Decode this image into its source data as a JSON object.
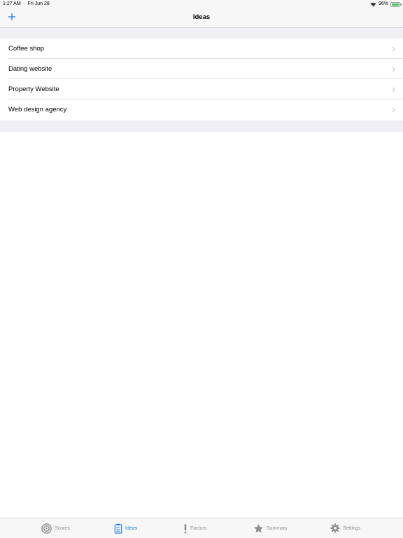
{
  "status_bar": {
    "time": "1:27 AM",
    "date": "Fri Jun 28",
    "battery": "96%",
    "battery_level": 0.96
  },
  "nav": {
    "title": "Ideas",
    "add_icon": "plus-icon"
  },
  "ideas": [
    {
      "label": "Coffee shop"
    },
    {
      "label": "Dating website"
    },
    {
      "label": "Property Website"
    },
    {
      "label": "Web design agency"
    }
  ],
  "tabs": [
    {
      "label": "Scores",
      "icon": "target-icon",
      "active": false
    },
    {
      "label": "Ideas",
      "icon": "clipboard-icon",
      "active": true
    },
    {
      "label": "Factors",
      "icon": "exclamation-icon",
      "active": false
    },
    {
      "label": "Summary",
      "icon": "star-icon",
      "active": false
    },
    {
      "label": "Settings",
      "icon": "gear-icon",
      "active": false
    }
  ],
  "colors": {
    "accent": "#1a7ce8",
    "inactive": "#8e8e93",
    "background": "#efeff4"
  }
}
